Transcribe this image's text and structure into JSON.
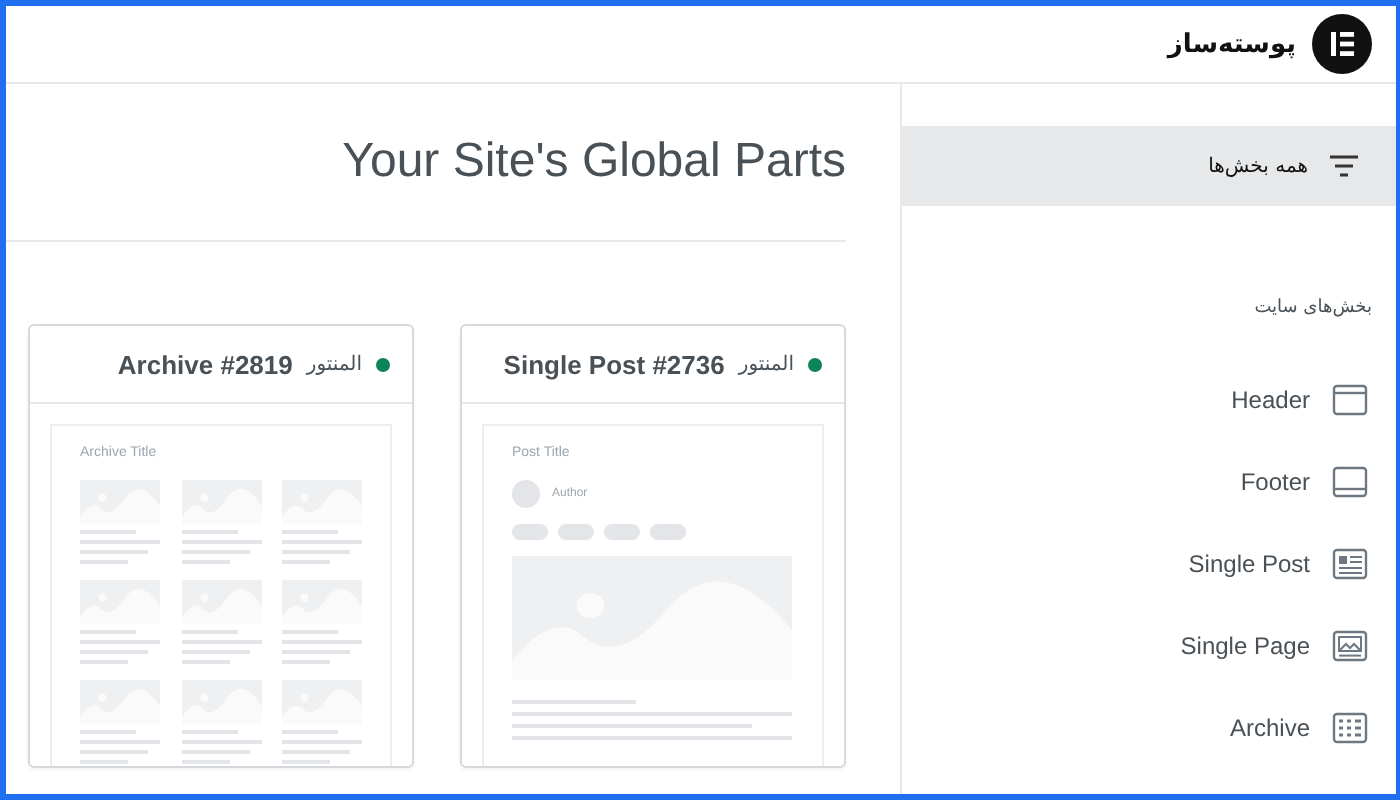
{
  "app": {
    "title": "پوسته‌ساز"
  },
  "heading": "Your Site's Global Parts",
  "cards": [
    {
      "kind": "single-post",
      "title": "Single Post #2736",
      "status": "المنتور",
      "color": "#0b8457",
      "preview_title": "Post Title",
      "author": "Author"
    },
    {
      "kind": "archive",
      "title": "Archive #2819",
      "status": "المنتور",
      "color": "#0b8457",
      "preview_title": "Archive Title"
    }
  ],
  "sidebar": {
    "filter": {
      "label": "همه بخش‌ها",
      "selected": true
    },
    "section_title": "بخش‌های سایت",
    "items": [
      {
        "kind": "header",
        "label": "Header"
      },
      {
        "kind": "footer",
        "label": "Footer"
      },
      {
        "kind": "single-post",
        "label": "Single Post"
      },
      {
        "kind": "single-page",
        "label": "Single Page"
      },
      {
        "kind": "archive",
        "label": "Archive"
      }
    ]
  }
}
